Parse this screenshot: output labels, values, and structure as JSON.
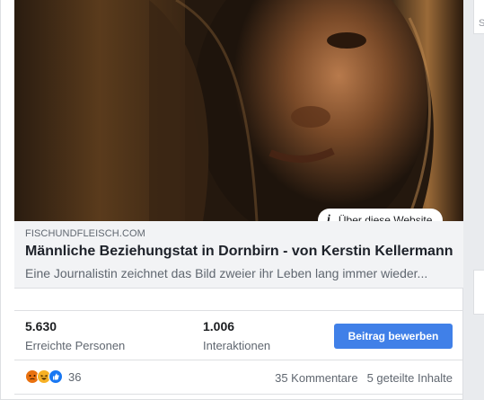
{
  "link_preview": {
    "about_label": "Über diese Website",
    "domain": "FISCHUNDFLEISCH.COM",
    "title": "Männliche Beziehungstat in Dornbirn - von Kerstin Kellermann",
    "description": "Eine Journalistin zeichnet das Bild zweier ihr Leben lang immer wieder..."
  },
  "stats": {
    "reach_value": "5.630",
    "reach_label": "Erreichte Personen",
    "interactions_value": "1.006",
    "interactions_label": "Interaktionen",
    "promote_label": "Beitrag bewerben"
  },
  "engagement": {
    "reaction_icons": [
      "angry-icon",
      "haha-icon",
      "like-icon"
    ],
    "reaction_count": "36",
    "comments": "35 Kommentare",
    "shares": "5 geteilte Inhalte"
  },
  "side": {
    "letter": "S"
  },
  "colors": {
    "accent": "#4080e8",
    "link_bg": "#f2f3f5",
    "muted_text": "#606770",
    "angry": "#e9710f",
    "haha": "#f7b125",
    "like": "#1877f2"
  }
}
